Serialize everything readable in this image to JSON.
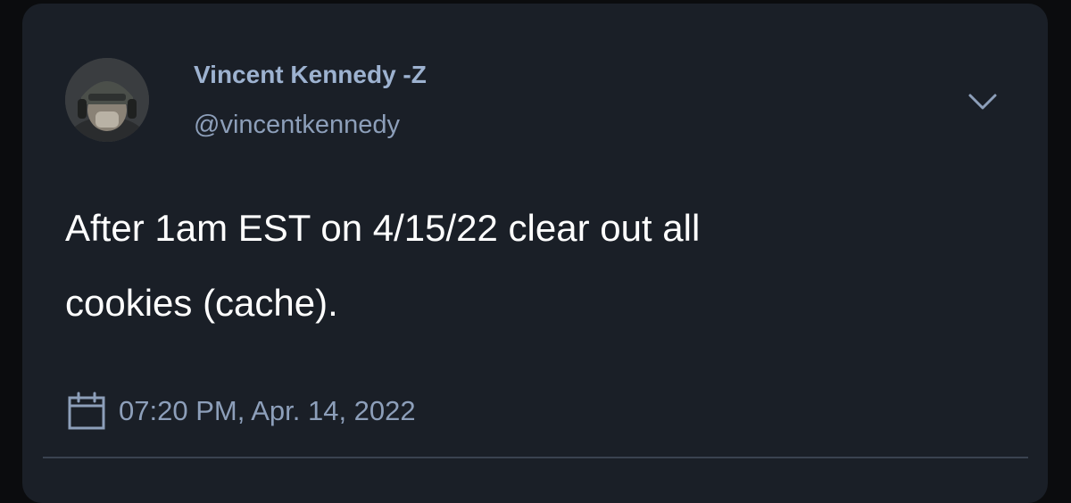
{
  "tweet": {
    "author_name": "Vincent Kennedy -Z",
    "author_handle": "@vincentkennedy",
    "text_line1": "After 1am EST on 4/15/22 clear out all",
    "text_line2": "cookies (cache).",
    "timestamp": "07:20 PM, Apr. 14, 2022"
  },
  "icons": {
    "menu": "chevron-down-icon",
    "date": "calendar-icon"
  },
  "colors": {
    "card_background": "#1a1f27",
    "page_background": "#0b0c0e",
    "name": "#9db2d0",
    "secondary_text": "#8d9fba",
    "body_text": "#ffffff"
  }
}
